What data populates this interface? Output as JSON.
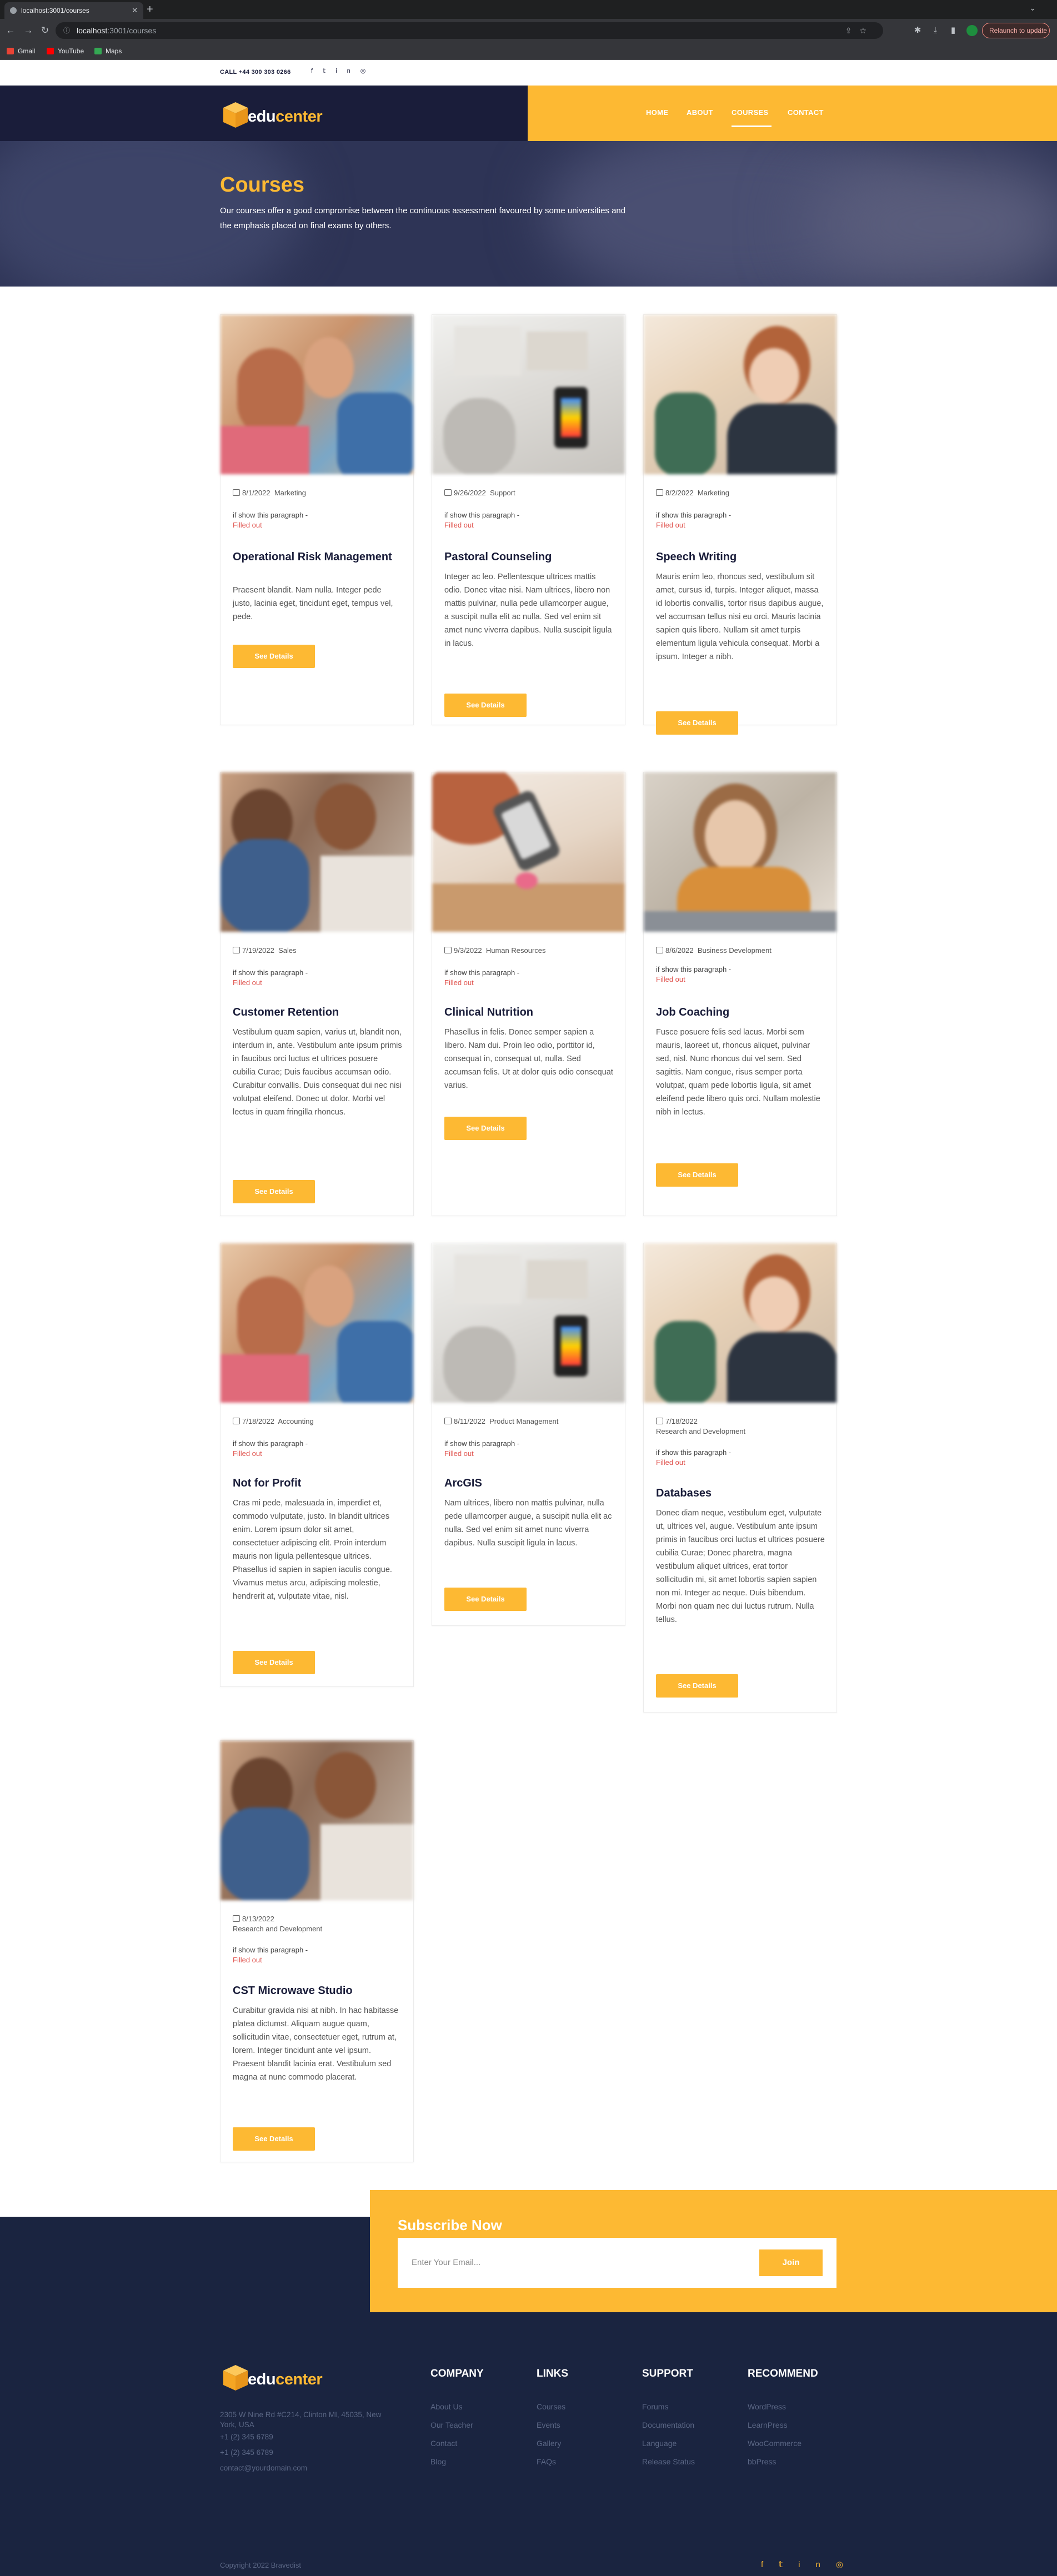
{
  "browser": {
    "tab_title": "localhost:3001/courses",
    "new_tab": "+",
    "url_host": "localhost",
    "url_path": ":3001/courses",
    "relaunch": "Relaunch to update",
    "profile_initial": "",
    "bookmarks": [
      {
        "label": "Gmail",
        "icon": "gmail-icon",
        "color": "#ea4335"
      },
      {
        "label": "YouTube",
        "icon": "youtube-icon",
        "color": "#ff0000"
      },
      {
        "label": "Maps",
        "icon": "maps-icon",
        "color": "#34a853"
      }
    ]
  },
  "topbar": {
    "call": "CALL +44 300 303 0266",
    "social_icons": [
      "facebook-icon",
      "twitter-icon",
      "linkedin-icon",
      "instagram-icon"
    ]
  },
  "header": {
    "logo_prefix": "edu",
    "logo_suffix": "center",
    "nav": [
      {
        "label": "HOME",
        "active": false
      },
      {
        "label": "ABOUT",
        "active": false
      },
      {
        "label": "COURSES",
        "active": true
      },
      {
        "label": "CONTACT",
        "active": false
      }
    ]
  },
  "hero": {
    "title": "Courses",
    "text": "Our courses offer a good compromise between the continuous assessment favoured by some universities and the emphasis placed on final exams by others."
  },
  "courses": [
    {
      "date": "8/1/2022",
      "category": "Marketing",
      "note": "if show this paragraph -",
      "status": "Filled out",
      "title": "Operational Risk Management",
      "text": "Praesent blandit. Nam nulla. Integer pede justo, lacinia eget, tincidunt eget, tempus vel, pede.",
      "button": "See Details"
    },
    {
      "date": "9/26/2022",
      "category": "Support",
      "note": "if show this paragraph -",
      "status": "Filled out",
      "title": "Pastoral Counseling",
      "text": "Integer ac leo. Pellentesque ultrices mattis odio. Donec vitae nisi. Nam ultrices, libero non mattis pulvinar, nulla pede ullamcorper augue, a suscipit nulla elit ac nulla. Sed vel enim sit amet nunc viverra dapibus. Nulla suscipit ligula in lacus.",
      "button": "See Details"
    },
    {
      "date": "8/2/2022",
      "category": "Marketing",
      "note": "if show this paragraph -",
      "status": "Filled out",
      "title": "Speech Writing",
      "text": "Mauris enim leo, rhoncus sed, vestibulum sit amet, cursus id, turpis. Integer aliquet, massa id lobortis convallis, tortor risus dapibus augue, vel accumsan tellus nisi eu orci. Mauris lacinia sapien quis libero. Nullam sit amet turpis elementum ligula vehicula consequat. Morbi a ipsum. Integer a nibh.",
      "button": "See Details"
    },
    {
      "date": "7/19/2022",
      "category": "Sales",
      "note": "if show this paragraph -",
      "status": "Filled out",
      "title": "Customer Retention",
      "text": "Vestibulum quam sapien, varius ut, blandit non, interdum in, ante. Vestibulum ante ipsum primis in faucibus orci luctus et ultrices posuere cubilia Curae; Duis faucibus accumsan odio. Curabitur convallis. Duis consequat dui nec nisi volutpat eleifend. Donec ut dolor. Morbi vel lectus in quam fringilla rhoncus.",
      "button": "See Details"
    },
    {
      "date": "9/3/2022",
      "category": "Human Resources",
      "note": "if show this paragraph -",
      "status": "Filled out",
      "title": "Clinical Nutrition",
      "text": "Phasellus in felis. Donec semper sapien a libero. Nam dui. Proin leo odio, porttitor id, consequat in, consequat ut, nulla. Sed accumsan felis. Ut at dolor quis odio consequat varius.",
      "button": "See Details"
    },
    {
      "date": "8/6/2022",
      "category": "Business Development",
      "note": "if show this paragraph -",
      "status": "Filled out",
      "title": "Job Coaching",
      "text": "Fusce posuere felis sed lacus. Morbi sem mauris, laoreet ut, rhoncus aliquet, pulvinar sed, nisl. Nunc rhoncus dui vel sem. Sed sagittis. Nam congue, risus semper porta volutpat, quam pede lobortis ligula, sit amet eleifend pede libero quis orci. Nullam molestie nibh in lectus.",
      "button": "See Details"
    },
    {
      "date": "7/18/2022",
      "category": "Accounting",
      "note": "if show this paragraph -",
      "status": "Filled out",
      "title": "Not for Profit",
      "text": "Cras mi pede, malesuada in, imperdiet et, commodo vulputate, justo. In blandit ultrices enim. Lorem ipsum dolor sit amet, consectetuer adipiscing elit. Proin interdum mauris non ligula pellentesque ultrices. Phasellus id sapien in sapien iaculis congue. Vivamus metus arcu, adipiscing molestie, hendrerit at, vulputate vitae, nisl.",
      "button": "See Details"
    },
    {
      "date": "8/11/2022",
      "category": "Product Management",
      "note": "if show this paragraph -",
      "status": "Filled out",
      "title": "ArcGIS",
      "text": "Nam ultrices, libero non mattis pulvinar, nulla pede ullamcorper augue, a suscipit nulla elit ac nulla. Sed vel enim sit amet nunc viverra dapibus. Nulla suscipit ligula in lacus.",
      "button": "See Details"
    },
    {
      "date": "7/18/2022",
      "category": "Research and Development",
      "note": "if show this paragraph -",
      "status": "Filled out",
      "title": "Databases",
      "text": "Donec diam neque, vestibulum eget, vulputate ut, ultrices vel, augue. Vestibulum ante ipsum primis in faucibus orci luctus et ultrices posuere cubilia Curae; Donec pharetra, magna vestibulum aliquet ultrices, erat tortor sollicitudin mi, sit amet lobortis sapien sapien non mi. Integer ac neque. Duis bibendum. Morbi non quam nec dui luctus rutrum. Nulla tellus.",
      "button": "See Details"
    },
    {
      "date": "8/13/2022",
      "category": "Research and Development",
      "note": "if show this paragraph -",
      "status": "Filled out",
      "title": "CST Microwave Studio",
      "text": "Curabitur gravida nisi at nibh. In hac habitasse platea dictumst. Aliquam augue quam, sollicitudin vitae, consectetuer eget, rutrum at, lorem. Integer tincidunt ante vel ipsum. Praesent blandit lacinia erat. Vestibulum sed magna at nunc commodo placerat.",
      "button": "See Details"
    }
  ],
  "subscribe": {
    "title": "Subscribe Now",
    "placeholder": "Enter Your Email...",
    "button": "Join"
  },
  "footer": {
    "address_lines": [
      "2305 W Nine Rd #C214, Clinton MI, 45035, New",
      "York, USA"
    ],
    "phones": [
      "+1 (2) 345 6789",
      "+1 (2) 345 6789"
    ],
    "email": "contact@yourdomain.com",
    "columns": [
      {
        "title": "COMPANY",
        "links": [
          "About Us",
          "Our Teacher",
          "Contact",
          "Blog"
        ]
      },
      {
        "title": "LINKS",
        "links": [
          "Courses",
          "Events",
          "Gallery",
          "FAQs"
        ]
      },
      {
        "title": "SUPPORT",
        "links": [
          "Forums",
          "Documentation",
          "Language",
          "Release Status"
        ]
      },
      {
        "title": "RECOMMEND",
        "links": [
          "WordPress",
          "LearnPress",
          "WooCommerce",
          "bbPress"
        ]
      }
    ],
    "copyright": "Copyright 2022 Bravedist",
    "social_icons": [
      "facebook-icon",
      "twitter-icon",
      "linkedin-icon",
      "instagram-icon"
    ]
  }
}
